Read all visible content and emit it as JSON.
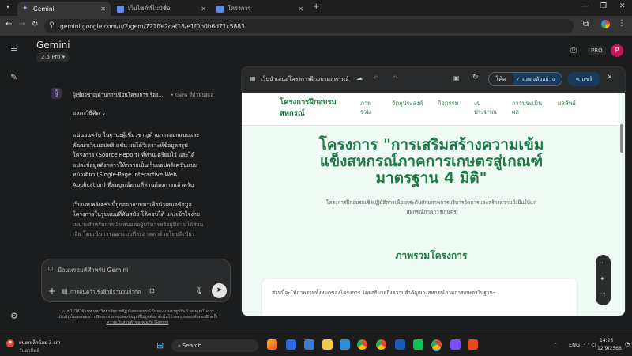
{
  "browser": {
    "tabs": [
      {
        "label": "Gemini",
        "favicon_color": "#4f8ef7",
        "active": true
      },
      {
        "label": "เว็บไซต์ที่ไม่มีชื่อ",
        "favicon_color": "#4f8ef7",
        "active": false
      },
      {
        "label": "โครงการ",
        "favicon_color": "#4f8ef7",
        "active": false
      }
    ],
    "new_tab_label": "+",
    "url": "gemini.google.com/u/2/gem/721ffe2caf18/e1f0b0b6d71c5883"
  },
  "gemini": {
    "title": "Gemini",
    "model": "2.5 Pro",
    "pro_badge": "PRO",
    "avatar_letter": "P",
    "gem_name": "ผู้เชี่ยวชาญด้านการเขียนโครงการเรื่อง...",
    "gem_suffix": "• Gem ที่กำหนดเอ",
    "show_thinking": "แสดงวิธีคิด",
    "response": [
      "แน่นอนครับ ในฐานะผู้เชี่ยวชาญด้านการออกแบบและ",
      "พัฒนาเว็บแอปพลิเคชัน ผมได้วิเคราะห์ข้อมูลสรุป",
      "โครงการ (Source Report) ที่ท่านเตรียมไว้ และได้",
      "แปลงข้อมูลดังกล่าวให้กลายเป็นเว็บแอปพลิเคชันแบบ",
      "หน้าเดียว (Single-Page Interactive Web",
      "Application) ที่สมบูรณ์ตามที่ท่านต้องการแล้วครับ",
      "",
      "เว็บแอปพลิเคชันนี้ถูกออกแบบมาเพื่อนำเสนอข้อมูล",
      "โครงการในรูปแบบที่ทันสมัย โต้ตอบได้ และเข้าใจง่าย",
      "เหมาะสำหรับการนำเสนอต่อผู้บริหารหรือผู้มีส่วนได้ส่วน",
      "เสีย โดยเน้นการออกแบบที่สะอาดตาด้วยโทนสีเขียว"
    ],
    "input_placeholder": "ป้อนพรอมต์สำหรับ Gemini",
    "research_chip": "การค้นคว้าเชิงลึกมีจำนวนจำกัด",
    "disclaimer": [
      "ระบบไม่ได้ใช้แชท มหาวิทยาลัยราชภัฏวไลยอลงกรณ์ ในพระบรมราชูปถัมภ์ ของคุณในการ",
      "ปรับปรุงโมเดลของเรา Gemini อาจแสดงข้อมูลที่ไม่ถูกต้อง ดังนั้นโปรดตรวจสอบคำตอบอีกครั้ง"
    ],
    "privacy_link": "ความเป็นส่วนตัวของคุณกับ Gemini"
  },
  "canvas": {
    "title": "เว็บนำเสนอโครงการฝึกอบรมสหกรณ์",
    "code_label": "โค้ด",
    "preview_label": "แสดงตัวอย่าง",
    "share_label": "แชร์",
    "site": {
      "brand": [
        "โครงการฝึกอบรม",
        "สหกรณ์"
      ],
      "nav": [
        [
          "ภาพ",
          "รวม"
        ],
        [
          "วัตถุประสงค์"
        ],
        [
          "กิจกรรม"
        ],
        [
          "งบ",
          "ประมาณ"
        ],
        [
          "การประเมิน",
          "ผล"
        ],
        [
          "ผลลัพธ์"
        ]
      ],
      "hero_title": [
        "โครงการ \"การเสริมสร้างความเข้ม",
        "แข็งสหกรณ์ภาคการเกษตรสู่เกณฑ์",
        "มาตรฐาน 4 มิติ\""
      ],
      "hero_sub": [
        "โครงการฝึกอบรมเชิงปฏิบัติการเพื่อยกระดับศักยภาพการบริหารจัดการและสร้างความยั่งยืนให้แก่",
        "สหกรณ์ภาคการเกษตร"
      ],
      "section_title": "ภาพรวมโครงการ",
      "card_text": "ส่วนนี้จะให้ภาพรวมทั้งหมดของโครงการ โดยอธิบายถึงความสำคัญของสหกรณ์ภาคการเกษตรในฐานะ"
    },
    "brand_color": "#1e7a45"
  },
  "taskbar": {
    "weather_temp": "ฝนตกเล็กน้อย 3 cm",
    "weather_sub": "วันอาทิตย์",
    "search_label": "Search",
    "lang": "ENG",
    "time": "14:25",
    "date": "12/9/2568"
  }
}
